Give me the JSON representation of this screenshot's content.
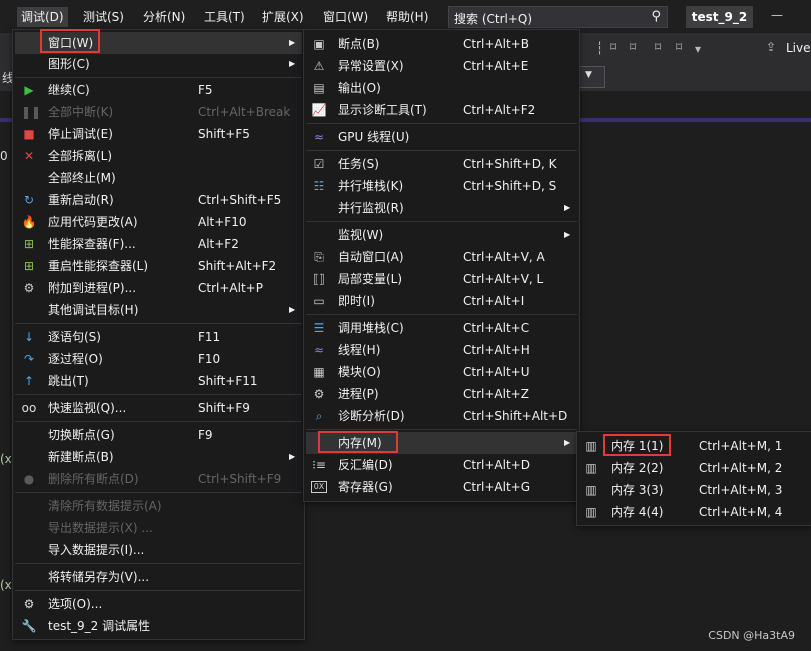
{
  "menubar": {
    "items": [
      "调试(D)",
      "测试(S)",
      "分析(N)",
      "工具(T)",
      "扩展(X)",
      "窗口(W)",
      "帮助(H)"
    ],
    "search_placeholder": "搜索 (Ctrl+Q)",
    "solution": "test_9_2",
    "liveshare": "Live"
  },
  "left_gutter": [
    "线",
    "0",
    "(x)",
    "(x)"
  ],
  "debug_menu": {
    "window": {
      "label": "窗口(W)"
    },
    "graphics": {
      "label": "图形(C)"
    },
    "continue": {
      "label": "继续(C)",
      "shortcut": "F5"
    },
    "break_all": {
      "label": "全部中断(K)",
      "shortcut": "Ctrl+Alt+Break"
    },
    "stop": {
      "label": "停止调试(E)",
      "shortcut": "Shift+F5"
    },
    "detach_all": {
      "label": "全部拆离(L)"
    },
    "terminate_all": {
      "label": "全部终止(M)"
    },
    "restart": {
      "label": "重新启动(R)",
      "shortcut": "Ctrl+Shift+F5"
    },
    "apply_code": {
      "label": "应用代码更改(A)",
      "shortcut": "Alt+F10"
    },
    "profiler": {
      "label": "性能探查器(F)...",
      "shortcut": "Alt+F2"
    },
    "relaunch_profiler": {
      "label": "重启性能探查器(L)",
      "shortcut": "Shift+Alt+F2"
    },
    "attach": {
      "label": "附加到进程(P)...",
      "shortcut": "Ctrl+Alt+P"
    },
    "other_targets": {
      "label": "其他调试目标(H)"
    },
    "step_into": {
      "label": "逐语句(S)",
      "shortcut": "F11"
    },
    "step_over": {
      "label": "逐过程(O)",
      "shortcut": "F10"
    },
    "step_out": {
      "label": "跳出(T)",
      "shortcut": "Shift+F11"
    },
    "quickwatch": {
      "label": "快速监视(Q)...",
      "shortcut": "Shift+F9"
    },
    "toggle_bp": {
      "label": "切换断点(G)",
      "shortcut": "F9"
    },
    "new_bp": {
      "label": "新建断点(B)"
    },
    "delete_bps": {
      "label": "删除所有断点(D)",
      "shortcut": "Ctrl+Shift+F9"
    },
    "clear_datatips": {
      "label": "清除所有数据提示(A)"
    },
    "export_datatips": {
      "label": "导出数据提示(X) ..."
    },
    "import_datatips": {
      "label": "导入数据提示(I)..."
    },
    "save_dump": {
      "label": "将转储另存为(V)..."
    },
    "options": {
      "label": "选项(O)..."
    },
    "properties": {
      "label": "test_9_2 调试属性"
    }
  },
  "window_menu": {
    "breakpoints": {
      "label": "断点(B)",
      "shortcut": "Ctrl+Alt+B"
    },
    "exception": {
      "label": "异常设置(X)",
      "shortcut": "Ctrl+Alt+E"
    },
    "output": {
      "label": "输出(O)"
    },
    "diag_tools": {
      "label": "显示诊断工具(T)",
      "shortcut": "Ctrl+Alt+F2"
    },
    "gpu_threads": {
      "label": "GPU 线程(U)"
    },
    "tasks": {
      "label": "任务(S)",
      "shortcut": "Ctrl+Shift+D, K"
    },
    "parallel_stacks": {
      "label": "并行堆栈(K)",
      "shortcut": "Ctrl+Shift+D, S"
    },
    "parallel_watch": {
      "label": "并行监视(R)"
    },
    "watch": {
      "label": "监视(W)"
    },
    "autos": {
      "label": "自动窗口(A)",
      "shortcut": "Ctrl+Alt+V, A"
    },
    "locals": {
      "label": "局部变量(L)",
      "shortcut": "Ctrl+Alt+V, L"
    },
    "immediate": {
      "label": "即时(I)",
      "shortcut": "Ctrl+Alt+I"
    },
    "call_stack": {
      "label": "调用堆栈(C)",
      "shortcut": "Ctrl+Alt+C"
    },
    "threads": {
      "label": "线程(H)",
      "shortcut": "Ctrl+Alt+H"
    },
    "modules": {
      "label": "模块(O)",
      "shortcut": "Ctrl+Alt+U"
    },
    "processes": {
      "label": "进程(P)",
      "shortcut": "Ctrl+Alt+Z"
    },
    "diag_analysis": {
      "label": "诊断分析(D)",
      "shortcut": "Ctrl+Shift+Alt+D"
    },
    "memory": {
      "label": "内存(M)"
    },
    "disassembly": {
      "label": "反汇编(D)",
      "shortcut": "Ctrl+Alt+D"
    },
    "registers": {
      "label": "寄存器(G)",
      "shortcut": "Ctrl+Alt+G"
    }
  },
  "memory_menu": {
    "m1": {
      "label": "内存 1(1)",
      "shortcut": "Ctrl+Alt+M, 1"
    },
    "m2": {
      "label": "内存 2(2)",
      "shortcut": "Ctrl+Alt+M, 2"
    },
    "m3": {
      "label": "内存 3(3)",
      "shortcut": "Ctrl+Alt+M, 3"
    },
    "m4": {
      "label": "内存 4(4)",
      "shortcut": "Ctrl+Alt+M, 4"
    }
  },
  "watermark": "CSDN @Ha3tA9",
  "colors": {
    "highlight_box": "#e03b3b",
    "menu_bg": "#1b1b1c",
    "disabled_text": "#656565"
  }
}
